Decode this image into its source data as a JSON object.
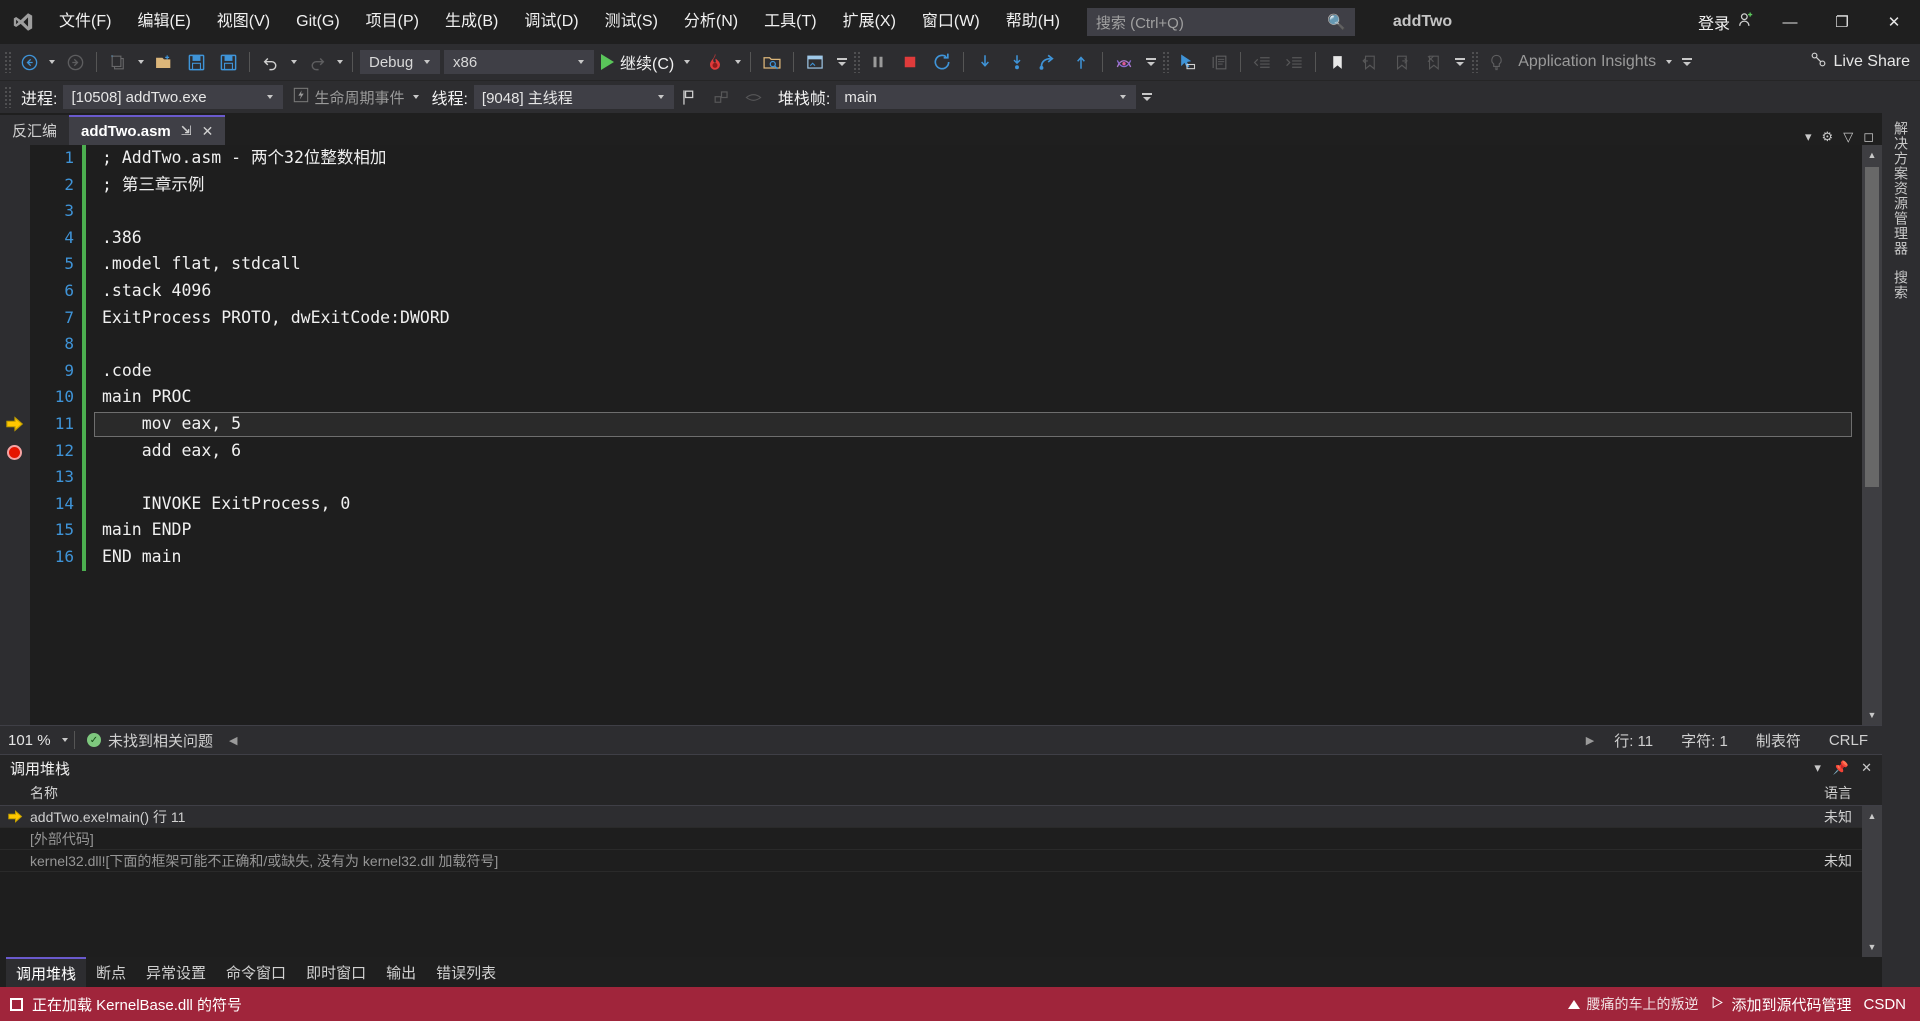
{
  "window": {
    "solution_name": "addTwo",
    "sign_in_label": "登录",
    "minimize": "—",
    "restore": "❐",
    "close": "✕"
  },
  "menu": {
    "items": [
      {
        "label": "文件(F)",
        "name": "menu-file"
      },
      {
        "label": "编辑(E)",
        "name": "menu-edit"
      },
      {
        "label": "视图(V)",
        "name": "menu-view"
      },
      {
        "label": "Git(G)",
        "name": "menu-git"
      },
      {
        "label": "项目(P)",
        "name": "menu-project"
      },
      {
        "label": "生成(B)",
        "name": "menu-build"
      },
      {
        "label": "调试(D)",
        "name": "menu-debug"
      },
      {
        "label": "测试(S)",
        "name": "menu-test"
      },
      {
        "label": "分析(N)",
        "name": "menu-analyze"
      },
      {
        "label": "工具(T)",
        "name": "menu-tools"
      },
      {
        "label": "扩展(X)",
        "name": "menu-extensions"
      },
      {
        "label": "窗口(W)",
        "name": "menu-window"
      },
      {
        "label": "帮助(H)",
        "name": "menu-help"
      }
    ]
  },
  "search": {
    "placeholder": "搜索 (Ctrl+Q)",
    "value": ""
  },
  "toolbar": {
    "configuration": "Debug",
    "platform": "x86",
    "continue_label": "继续(C)",
    "application_insights": "Application Insights",
    "live_share": "Live Share"
  },
  "debug_context": {
    "process_label": "进程:",
    "process_value": "[10508] addTwo.exe",
    "lifecycle_label": "生命周期事件",
    "thread_label": "线程:",
    "thread_value": "[9048] 主线程",
    "frame_label": "堆栈帧:",
    "frame_value": "main"
  },
  "editor": {
    "tabs": [
      {
        "label": "反汇编",
        "active": false
      },
      {
        "label": "addTwo.asm",
        "active": true
      }
    ],
    "pin_glyph": "⇲",
    "close_glyph": "✕",
    "current_line": 11,
    "breakpoint_line": 12,
    "lines": [
      {
        "n": 1,
        "text": "; AddTwo.asm - 两个32位整数相加",
        "changed": true
      },
      {
        "n": 2,
        "text": "; 第三章示例",
        "changed": true
      },
      {
        "n": 3,
        "text": "",
        "changed": true
      },
      {
        "n": 4,
        "text": ".386",
        "changed": true
      },
      {
        "n": 5,
        "text": ".model flat, stdcall",
        "changed": true
      },
      {
        "n": 6,
        "text": ".stack 4096",
        "changed": true
      },
      {
        "n": 7,
        "text": "ExitProcess PROTO, dwExitCode:DWORD",
        "changed": true
      },
      {
        "n": 8,
        "text": "",
        "changed": true
      },
      {
        "n": 9,
        "text": ".code",
        "changed": true
      },
      {
        "n": 10,
        "text": "main PROC",
        "changed": true
      },
      {
        "n": 11,
        "text": "    mov eax, 5",
        "changed": true
      },
      {
        "n": 12,
        "text": "    add eax, 6",
        "changed": true
      },
      {
        "n": 13,
        "text": "",
        "changed": true
      },
      {
        "n": 14,
        "text": "    INVOKE ExitProcess, 0",
        "changed": true
      },
      {
        "n": 15,
        "text": "main ENDP",
        "changed": true
      },
      {
        "n": 16,
        "text": "END main",
        "changed": true
      }
    ]
  },
  "editor_status": {
    "zoom": "101 %",
    "problems": "未找到相关问题",
    "line": "行: 11",
    "column": "字符: 1",
    "tabs_mode": "制表符",
    "line_ending": "CRLF"
  },
  "right_edge": {
    "solution_explorer": "解决方案资源管理器",
    "search": "搜索"
  },
  "call_stack": {
    "title": "调用堆栈",
    "columns": {
      "name": "名称",
      "language": "语言"
    },
    "rows": [
      {
        "name": "addTwo.exe!main() 行 11",
        "language": "未知",
        "current": true,
        "muted": false
      },
      {
        "name": "[外部代码]",
        "language": "",
        "current": false,
        "muted": true
      },
      {
        "name": "kernel32.dll![下面的框架可能不正确和/或缺失, 没有为 kernel32.dll 加载符号]",
        "language": "未知",
        "current": false,
        "muted": true
      }
    ],
    "tabs": [
      {
        "label": "调用堆栈",
        "active": true
      },
      {
        "label": "断点",
        "active": false
      },
      {
        "label": "异常设置",
        "active": false
      },
      {
        "label": "命令窗口",
        "active": false
      },
      {
        "label": "即时窗口",
        "active": false
      },
      {
        "label": "输出",
        "active": false
      },
      {
        "label": "错误列表",
        "active": false
      }
    ]
  },
  "status_bar": {
    "message": "正在加载 KernelBase.dll 的符号",
    "watermark": "腰痛的车上的叛逆",
    "source_control": "添加到源代码管理",
    "csdn": "CSDN"
  },
  "colors": {
    "accent_purple": "#6a5acd",
    "debug_red": "#a0253b",
    "breakpoint": "#e51400",
    "change_bar": "#4caf50",
    "line_number": "#3f94d8"
  }
}
